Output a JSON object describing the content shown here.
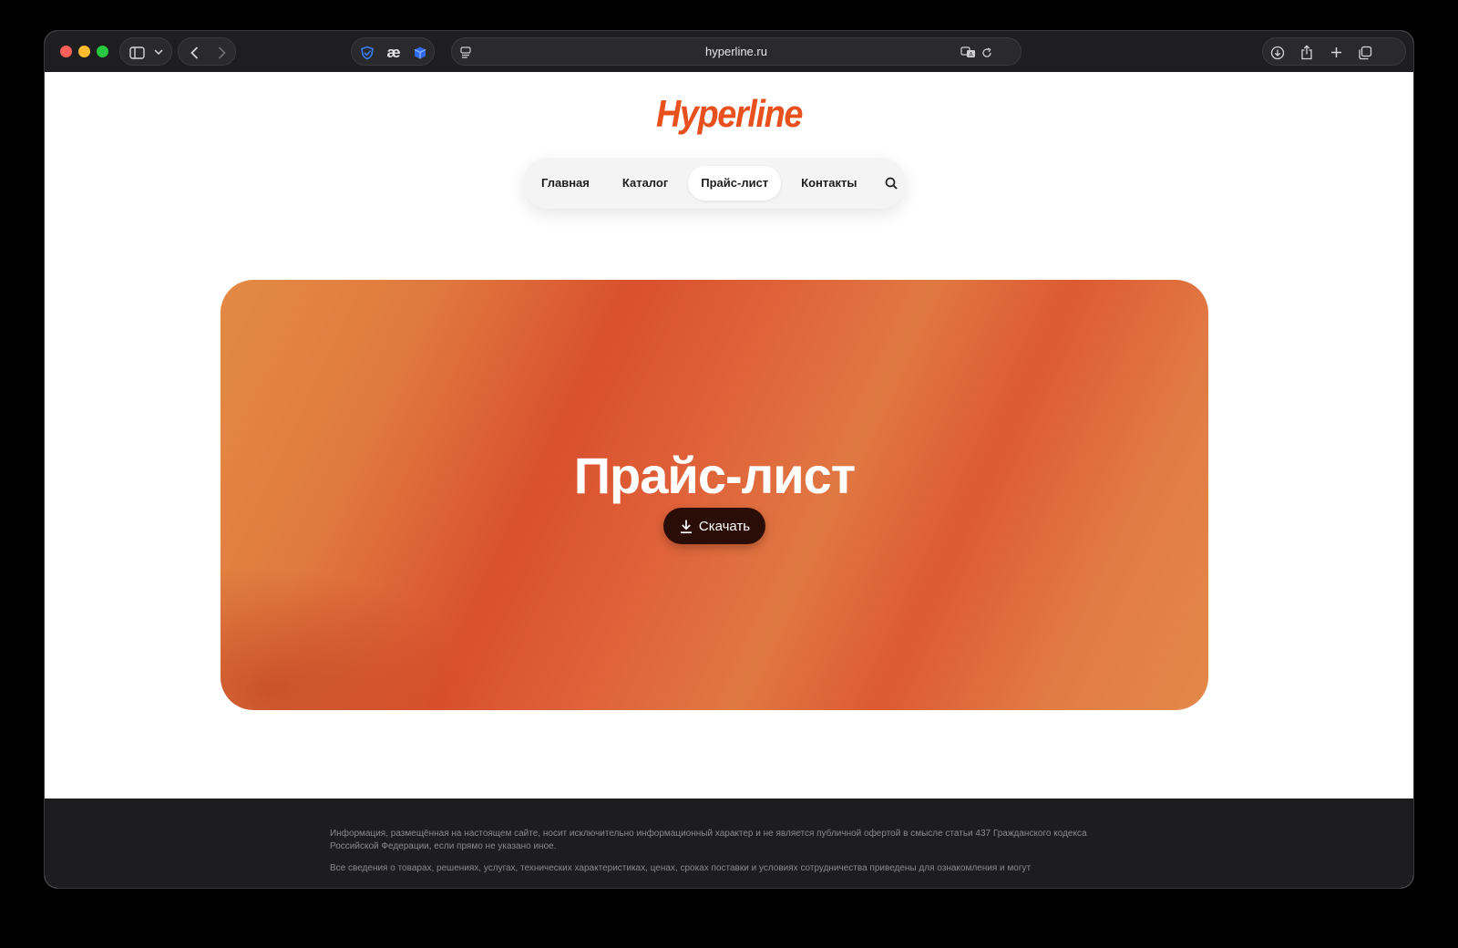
{
  "browser": {
    "url": "hyperline.ru"
  },
  "site": {
    "logo": "Hyperline",
    "brand_color": "#e8501e"
  },
  "nav": {
    "items": [
      {
        "label": "Главная",
        "active": false
      },
      {
        "label": "Каталог",
        "active": false
      },
      {
        "label": "Прайс-лист",
        "active": true
      },
      {
        "label": "Контакты",
        "active": false
      }
    ]
  },
  "hero": {
    "title": "Прайс-лист",
    "download_label": "Скачать"
  },
  "footer": {
    "text_1": "Информация, размещённая на настоящем сайте, носит исключительно информационный характер и не является публичной офертой в смысле статьи 437 Гражданского кодекса Российской Федерации, если прямо не указано иное.",
    "text_2": "Все сведения о товарах, решениях, услугах, технических характеристиках, ценах, сроках поставки и условиях сотрудничества приведены для ознакомления и могут"
  }
}
